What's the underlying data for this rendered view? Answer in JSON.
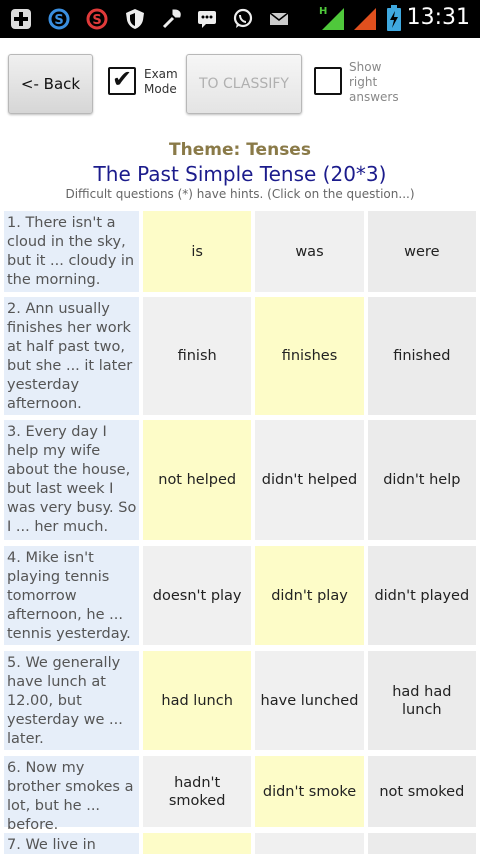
{
  "status_bar": {
    "time": "13:31",
    "icons": [
      "plus-icon",
      "skype-icon",
      "s-app-icon",
      "shield-icon",
      "wrench-icon",
      "chat-icon",
      "whatsapp-icon",
      "mail-icon",
      "signal-h-icon",
      "signal-icon",
      "battery-icon"
    ]
  },
  "toolbar": {
    "back_label": "<- Back",
    "exam_mode_label_1": "Exam",
    "exam_mode_label_2": "Mode",
    "exam_mode_checked": true,
    "classify_label": "TO CLASSIFY",
    "show_label_1": "Show",
    "show_label_2": "right",
    "show_label_3": "answers",
    "show_checked": false
  },
  "header": {
    "theme": "Theme: Tenses",
    "title": "The Past Simple Tense (20*3)",
    "subtitle": "Difficult questions (*) have hints. (Click on the question...)"
  },
  "questions": [
    {
      "text": "1. There isn't a cloud in the sky, but it ... cloudy in the morning.",
      "answers": [
        "is",
        "was",
        "were"
      ]
    },
    {
      "text": "2. Ann usually finishes her work at half past two, but she ... it later yesterday afternoon.",
      "answers": [
        "finish",
        "finishes",
        "finished"
      ]
    },
    {
      "text": "3. Every day I help my wife about the house, but last week I was very busy. So I ... her much.",
      "answers": [
        "not helped",
        "didn't helped",
        "didn't help"
      ]
    },
    {
      "text": "4. Mike isn't playing tennis tomorrow afternoon, he ... tennis yesterday.",
      "answers": [
        "doesn't play",
        "didn't play",
        "didn't played"
      ]
    },
    {
      "text": "5. We generally have lunch at 12.00, but yesterday we ... later.",
      "answers": [
        "had lunch",
        "have lunched",
        "had had lunch"
      ]
    },
    {
      "text": "6. Now my brother smokes a lot, but he ... before.",
      "answers": [
        "hadn't smoked",
        "didn't smoke",
        "not smoked"
      ]
    },
    {
      "text": "7. We live in",
      "answers": [
        "",
        "",
        ""
      ]
    }
  ],
  "colors": {
    "question_bg": "#e6eef9",
    "highlight": "#fdfcc8",
    "cell_grey": "#f0f0f0",
    "title_blue": "#1c1c8c",
    "theme_gold": "#8a7a48"
  }
}
